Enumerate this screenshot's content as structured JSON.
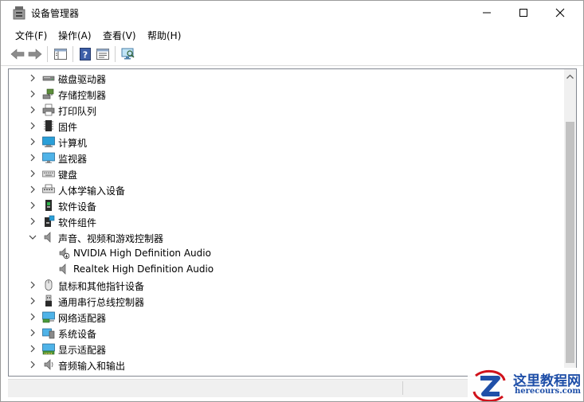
{
  "window": {
    "title": "设备管理器"
  },
  "menu": [
    "文件(F)",
    "操作(A)",
    "查看(V)",
    "帮助(H)"
  ],
  "tree": [
    {
      "label": "磁盘驱动器",
      "icon": "disk-drive-icon",
      "expanded": false
    },
    {
      "label": "存储控制器",
      "icon": "storage-controller-icon",
      "expanded": false
    },
    {
      "label": "打印队列",
      "icon": "printer-icon",
      "expanded": false
    },
    {
      "label": "固件",
      "icon": "firmware-icon",
      "expanded": false
    },
    {
      "label": "计算机",
      "icon": "computer-icon",
      "expanded": false
    },
    {
      "label": "监视器",
      "icon": "monitor-icon",
      "expanded": false
    },
    {
      "label": "键盘",
      "icon": "keyboard-icon",
      "expanded": false
    },
    {
      "label": "人体学输入设备",
      "icon": "hid-icon",
      "expanded": false
    },
    {
      "label": "软件设备",
      "icon": "software-device-icon",
      "expanded": false
    },
    {
      "label": "软件组件",
      "icon": "software-component-icon",
      "expanded": false
    },
    {
      "label": "声音、视频和游戏控制器",
      "icon": "speaker-icon",
      "expanded": true
    },
    {
      "label": "NVIDIA High Definition Audio",
      "icon": "audio-device-disabled-icon",
      "child": true
    },
    {
      "label": "Realtek High Definition Audio",
      "icon": "audio-device-icon",
      "child": true
    },
    {
      "label": "鼠标和其他指针设备",
      "icon": "mouse-icon",
      "expanded": false
    },
    {
      "label": "通用串行总线控制器",
      "icon": "usb-icon",
      "expanded": false
    },
    {
      "label": "网络适配器",
      "icon": "network-adapter-icon",
      "expanded": false
    },
    {
      "label": "系统设备",
      "icon": "system-device-icon",
      "expanded": false
    },
    {
      "label": "显示适配器",
      "icon": "display-adapter-icon",
      "expanded": false
    },
    {
      "label": "音频输入和输出",
      "icon": "audio-io-icon",
      "expanded": false
    }
  ],
  "watermark": {
    "text": "这里教程网",
    "url": "herecours.com"
  }
}
